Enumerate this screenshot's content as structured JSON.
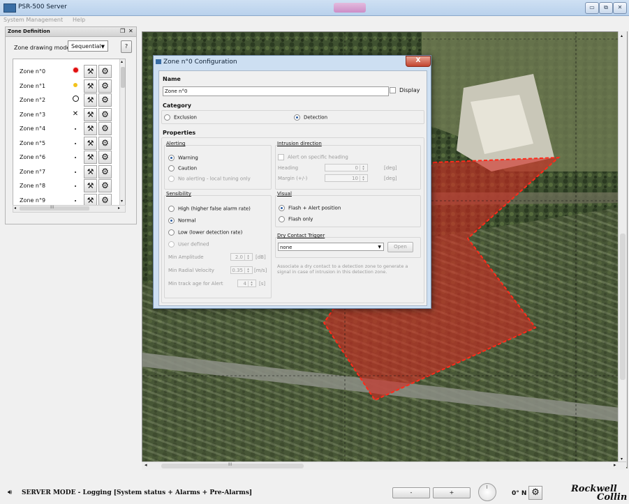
{
  "window": {
    "title": "PSR-500 Server",
    "controls": {
      "minimize": "▭",
      "maximize": "⧉",
      "close": "✕"
    }
  },
  "menu": {
    "items": [
      "System Management",
      "Help"
    ]
  },
  "zone_panel": {
    "title": "Zone Definition",
    "float_icon": "float-icon",
    "close_icon": "close-icon",
    "mode_label": "Zone drawing mode",
    "mode_value": "Sequential",
    "help_label": "?",
    "zones": [
      {
        "label": "Zone n°0",
        "indicator": "red-dot"
      },
      {
        "label": "Zone n°1",
        "indicator": "yellow-dot"
      },
      {
        "label": "Zone n°2",
        "indicator": "ring"
      },
      {
        "label": "Zone n°3",
        "indicator": "cross"
      },
      {
        "label": "Zone n°4",
        "indicator": "small-dot"
      },
      {
        "label": "Zone n°5",
        "indicator": "small-dot"
      },
      {
        "label": "Zone n°6",
        "indicator": "small-dot"
      },
      {
        "label": "Zone n°7",
        "indicator": "small-dot"
      },
      {
        "label": "Zone n°8",
        "indicator": "small-dot"
      },
      {
        "label": "Zone n°9",
        "indicator": "small-dot"
      }
    ],
    "scroll_grip": "III"
  },
  "dialog": {
    "title": "Zone n°0 Configuration",
    "close_label": "X",
    "name_section": "Name",
    "name_value": "Zone n°0",
    "display_label": "Display",
    "display_checked": false,
    "category_section": "Category",
    "category_options": [
      "Exclusion",
      "Detection"
    ],
    "category_selected": "Detection",
    "properties_section": "Properties",
    "alerting": {
      "title": "Alerting",
      "options": [
        "Warning",
        "Caution",
        "No alerting - local tuning only"
      ],
      "selected": "Warning"
    },
    "intrusion": {
      "title": "Intrusion direction",
      "checkbox": "Alert on specific heading",
      "heading_label": "Heading",
      "heading_value": "0",
      "margin_label": "Margin (+/-)",
      "margin_value": "10",
      "unit": "[deg]"
    },
    "sensibility": {
      "title": "Sensibility",
      "options": [
        "High (higher false alarm rate)",
        "Normal",
        "Low (lower detection rate)",
        "User defined"
      ],
      "selected": "Normal",
      "min_amplitude_label": "Min Amplitude",
      "min_amplitude_value": "2.0",
      "min_amplitude_unit": "[dB]",
      "min_velocity_label": "Min Radial Velocity",
      "min_velocity_value": "0.35",
      "min_velocity_unit": "[m/s]",
      "min_track_label": "Min track age for Alert",
      "min_track_value": "4",
      "min_track_unit": "[s]"
    },
    "visual": {
      "title": "Visual",
      "options": [
        "Flash + Alert position",
        "Flash only"
      ],
      "selected": "Flash + Alert position"
    },
    "dry_contact": {
      "title": "Dry Contact Trigger",
      "value": "none",
      "open_label": "Open",
      "help_text": "Associate a dry contact to a detection zone to generate a signal in case of intrusion in this detection zone."
    }
  },
  "map": {
    "scroll_grip": "III",
    "left_arrow": "◂",
    "right_arrow": "▸",
    "up_arrow": "▴",
    "down_arrow": "▾"
  },
  "statusbar": {
    "text": "SERVER MODE - Logging [System status + Alarms + Pre-Alarms]",
    "zoom_out": "-",
    "zoom_in": "+",
    "heading": "0° N",
    "logo_line1": "Rockwell",
    "logo_line2": "Collin"
  },
  "colors": {
    "zone_fill": "#d42a22",
    "zone_stroke": "#ff2a1a",
    "radio_selected": "#2c5ea3"
  }
}
